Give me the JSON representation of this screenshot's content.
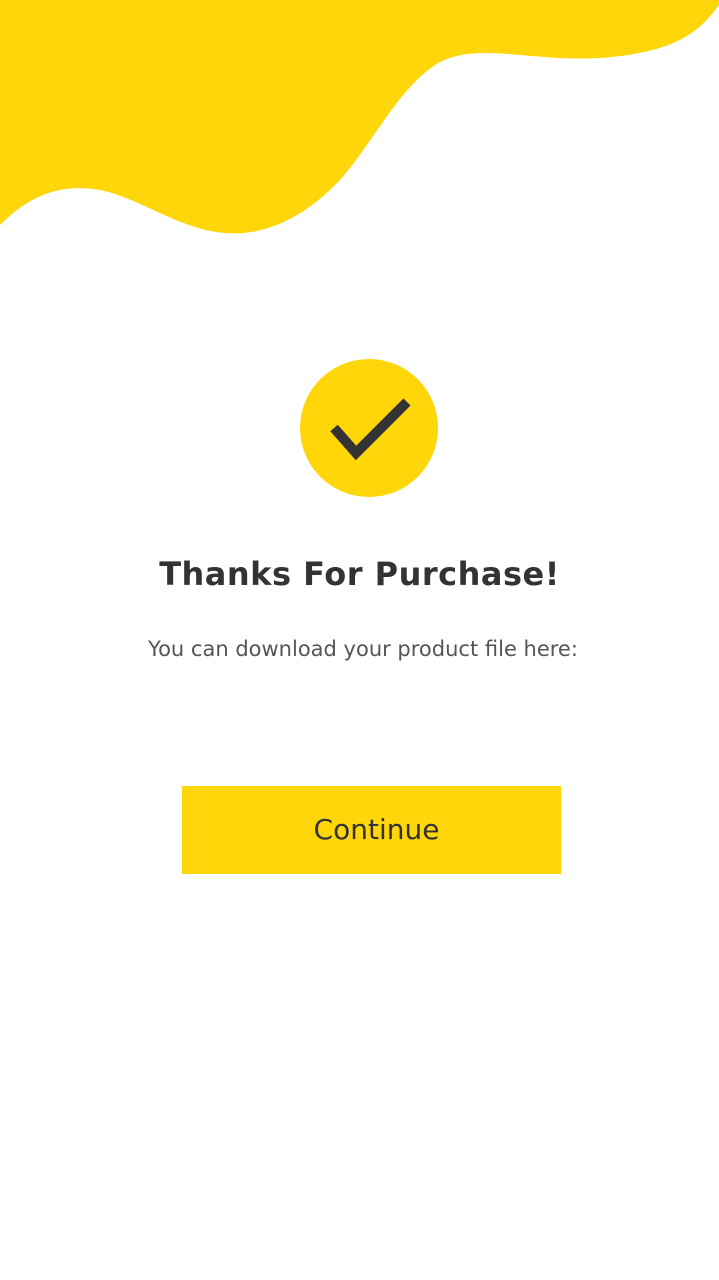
{
  "theme": {
    "accent_color": "#FFD60A",
    "text_dark": "#333333",
    "text_muted": "#555555",
    "background": "#FFFFFF"
  },
  "header": {
    "decoration": "yellow-wave"
  },
  "status_icon": {
    "icon": "checkmark-icon"
  },
  "confirmation": {
    "title": "Thanks For Purchase!",
    "message": "You can download your product file here:"
  },
  "actions": {
    "continue_label": "Continue"
  }
}
